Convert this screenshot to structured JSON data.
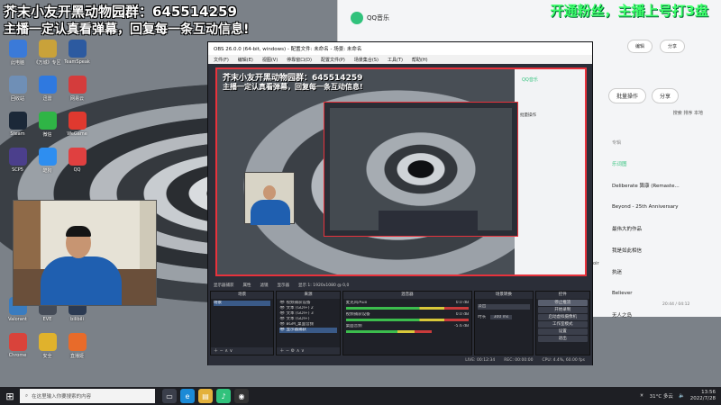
{
  "overlay": {
    "line1": "芥末小友开黑动物园群：645514259",
    "line2": "主播一定认真看弹幕，回复每一条互动信息!",
    "green_banner": "开通粉丝，主播上号打3盘"
  },
  "desktop": {
    "icons": [
      {
        "label": "此电脑",
        "color": "#3b7ad8"
      },
      {
        "label": "《万城》专区",
        "color": "#c9a23a"
      },
      {
        "label": "TeamSpeak",
        "color": "#2c5aa0"
      },
      {
        "label": "回收站",
        "color": "#6f8fb6"
      },
      {
        "label": "迅雷",
        "color": "#2f79e0"
      },
      {
        "label": "网易云",
        "color": "#d43c3c"
      },
      {
        "label": "Steam",
        "color": "#1b2838"
      },
      {
        "label": "微信",
        "color": "#2fb546"
      },
      {
        "label": "WeGame",
        "color": "#e0392f"
      },
      {
        "label": "SCP5",
        "color": "#4b3f8c"
      },
      {
        "label": "酷狗",
        "color": "#2e8ef0"
      },
      {
        "label": "QQ",
        "color": "#e04040"
      }
    ],
    "bottom_icons": [
      {
        "label": "Valorant",
        "color": "#3a7cbf"
      },
      {
        "label": "EVE",
        "color": "#444b57"
      },
      {
        "label": "bilibili",
        "color": "#2b3a52"
      },
      {
        "label": "Chrome",
        "color": "#d9433b"
      },
      {
        "label": "安全",
        "color": "#e0b22c"
      },
      {
        "label": "直播姬",
        "color": "#e86b2a"
      }
    ]
  },
  "qq_music": {
    "title": "QQ音乐",
    "btn_edit": "编辑",
    "btn_share": "分享",
    "btn_batch": "批量操作",
    "btn_share2": "分享",
    "right_labels": {
      "search": "搜索",
      "sort": "排序",
      "local": "本地"
    },
    "list": [
      {
        "text": "专辑",
        "type": "head"
      },
      {
        "text": "乐词图",
        "type": "active"
      },
      {
        "text": "Deliberate 算康 (Remaste...",
        "type": "item"
      },
      {
        "text": "Beyond - 25th Anniversary",
        "type": "item"
      },
      {
        "text": "最伟大的作品",
        "type": "item"
      },
      {
        "text": "我是如此相信",
        "type": "item"
      },
      {
        "text": "执迷",
        "type": "item"
      },
      {
        "text": "Believer",
        "type": "item"
      },
      {
        "text": "无人之岛",
        "type": "item"
      }
    ],
    "side_label": "Children's Choir",
    "player_time": "20:44 / 04:12"
  },
  "obs": {
    "titlebar": "OBS 26.0.0 (64-bit, windows) - 配置文件: 未命名 - 场景: 未命名",
    "menu": [
      "文件(F)",
      "编辑(E)",
      "视图(V)",
      "停靠窗口(D)",
      "配置文件(P)",
      "场景集合(S)",
      "工具(T)",
      "帮助(H)"
    ],
    "preview_line1": "芥末小友开黑动物园群：645514259",
    "preview_line2": "主播一定认真看弹幕，回复每一条互动信息!",
    "status_row": [
      "显示器捕获",
      "属性",
      "滤镜",
      "显示器",
      "显示 1: 1920x1080 @ 0,0"
    ],
    "panels": {
      "scenes_title": "场景",
      "scenes": [
        "场景"
      ],
      "sources_title": "来源",
      "sources": [
        "视频捕获设备",
        "文本 (GDI+) 2",
        "文本 (GDI+) 3",
        "文本 (GDI+)",
        "BGM_桌面音频",
        "显示器捕获"
      ],
      "mixer_title": "混音器",
      "mixer": [
        {
          "name": "麦克风/Aux",
          "db": "0.0 dB"
        },
        {
          "name": "视频捕获设备",
          "db": "0.0 dB"
        },
        {
          "name": "桌面音频",
          "db": "-5.6 dB"
        }
      ],
      "transitions_title": "场景转换",
      "transition_value": "淡出",
      "duration_label": "时长",
      "duration_value": "300 ms",
      "controls_title": "控件",
      "controls": [
        "停止推流",
        "开始录制",
        "启动虚拟摄像机",
        "工作室模式",
        "设置",
        "退出"
      ]
    },
    "footer": [
      "LIVE: 00:12:34",
      "REC: 00:00:00",
      "CPU: 4.4%, 60.00 fps"
    ]
  },
  "taskbar": {
    "search_placeholder": "在这里输入你要搜索的内容",
    "apps": [
      {
        "name": "task-view",
        "color": "#3b3f4b",
        "glyph": "▭"
      },
      {
        "name": "edge",
        "color": "#1b8ad6",
        "glyph": "e"
      },
      {
        "name": "file-explorer",
        "color": "#e3b13c",
        "glyph": "▤"
      },
      {
        "name": "qq-music",
        "color": "#31c27c",
        "glyph": "♪"
      },
      {
        "name": "obs",
        "color": "#333",
        "glyph": "◉"
      }
    ],
    "weather": "31°C 多云",
    "time": "13:56",
    "date": "2022/7/28"
  }
}
